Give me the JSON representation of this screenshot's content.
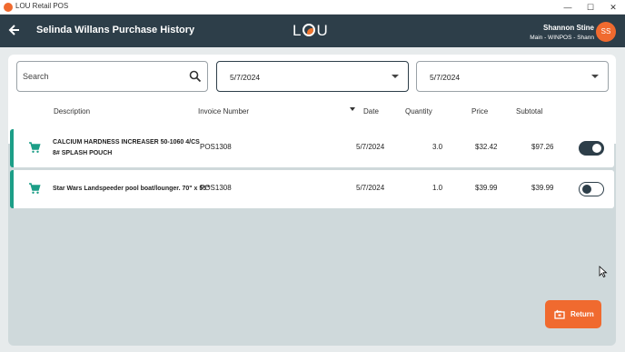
{
  "window": {
    "title": "LOU Retail POS",
    "controls": [
      "—",
      "☐",
      "✕"
    ]
  },
  "header": {
    "back_icon": "arrow-left-icon",
    "title": "Selinda Willans Purchase History",
    "logo": {
      "l": "L",
      "u": "U"
    },
    "user_name": "Shannon Stine",
    "user_location": "Main - WINPOS - Shann",
    "avatar_initials": "SS"
  },
  "filters": {
    "search_placeholder": "Search",
    "date_from": "5/7/2024",
    "date_to": "5/7/2024"
  },
  "table": {
    "columns": {
      "description": "Description",
      "invoice": "Invoice Number",
      "date": "Date",
      "quantity": "Quantity",
      "price": "Price",
      "subtotal": "Subtotal"
    },
    "rows": [
      {
        "description": "CALCIUM HARDNESS INCREASER 50-1060 4/CS 8# SPLASH POUCH",
        "invoice": "POS1308",
        "date": "5/7/2024",
        "quantity": "3.0",
        "price": "$32.42",
        "subtotal": "$97.26",
        "selected": true
      },
      {
        "description": "Star Wars Landspeeder pool boat/lounger. 70\" x 55\"",
        "invoice": "POS1308",
        "date": "5/7/2024",
        "quantity": "1.0",
        "price": "$39.99",
        "subtotal": "$39.99",
        "selected": false
      }
    ]
  },
  "actions": {
    "return_label": "Return"
  },
  "colors": {
    "header_bg": "#2d3e49",
    "accent_orange": "#f06a2f",
    "row_accent_teal": "#1c9e87",
    "panel_bg": "#cfd9db"
  }
}
